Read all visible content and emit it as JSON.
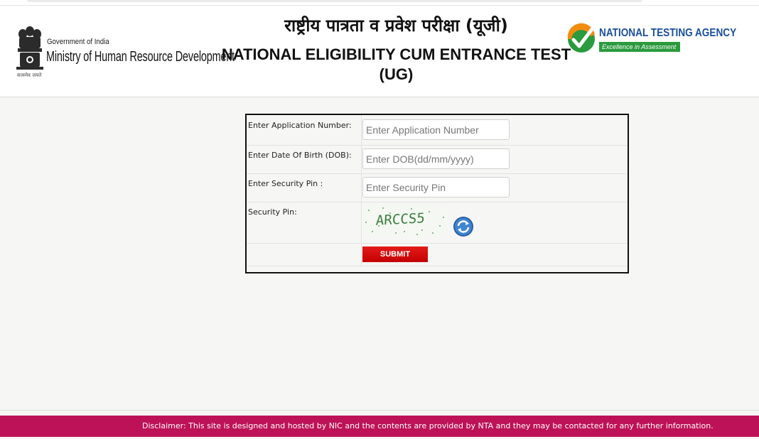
{
  "header": {
    "emblem_motto": "सत्यमेव जयते",
    "gov_label": "Government of India",
    "ministry": "Ministry of Human Resource Development",
    "hindi_title": "राष्ट्रीय पात्रता व प्रवेश परीक्षा (यूजी)",
    "english_title": "NATIONAL ELIGIBILITY CUM ENTRANCE TEST (UG)",
    "agency_name": "NATIONAL TESTING AGENCY",
    "agency_tagline": "Excellence in Assessment"
  },
  "form": {
    "application_label": "Enter Application Number:",
    "application_placeholder": "Enter Application Number",
    "dob_label": "Enter Date Of Birth (DOB):",
    "dob_placeholder": "Enter DOB(dd/mm/yyyy)",
    "pin_label": "Enter Security Pin :",
    "pin_placeholder": "Enter Security Pin",
    "captcha_label": "Security Pin:",
    "captcha_text": "ARCCS5",
    "submit_label": "SUBMIT"
  },
  "footer": {
    "disclaimer": "Disclaimer: This site is designed and hosted by NIC and the contents are provided by NTA and they may be contacted for any further information."
  },
  "colors": {
    "footer_bg": "#bd1257",
    "submit_bg": "#d40f0f",
    "nta_blue": "#1a4f9c",
    "nta_green": "#2c9a3e",
    "nta_orange": "#f28c0f"
  },
  "icons": [
    "national-emblem-icon",
    "nta-check-logo-icon",
    "refresh-captcha-icon"
  ]
}
